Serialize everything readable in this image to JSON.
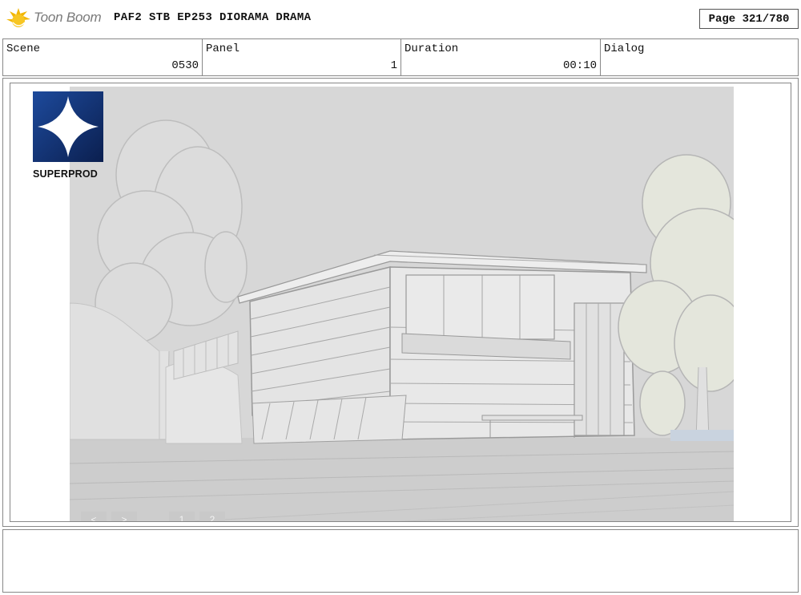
{
  "header": {
    "brand": "Toon Boom",
    "project_title": "PAF2 STB EP253 DIORAMA DRAMA",
    "page": "Page 321/780"
  },
  "info": {
    "scene": {
      "label": "Scene",
      "value": "0530"
    },
    "panel": {
      "label": "Panel",
      "value": "1"
    },
    "duration": {
      "label": "Duration",
      "value": "00:10"
    },
    "dialog": {
      "label": "Dialog",
      "value": ""
    }
  },
  "panel_image": {
    "studio_logo": "SUPERPROD",
    "nav": {
      "prev": "<",
      "next": ">",
      "page_1": "1",
      "page_2": "2"
    }
  },
  "colors": {
    "background": "#ffffff",
    "sky": "#d6d6d6",
    "ground": "#cfcfcf",
    "logo_accent": "#f2b705",
    "superprod_blue": "#1b3e86"
  }
}
